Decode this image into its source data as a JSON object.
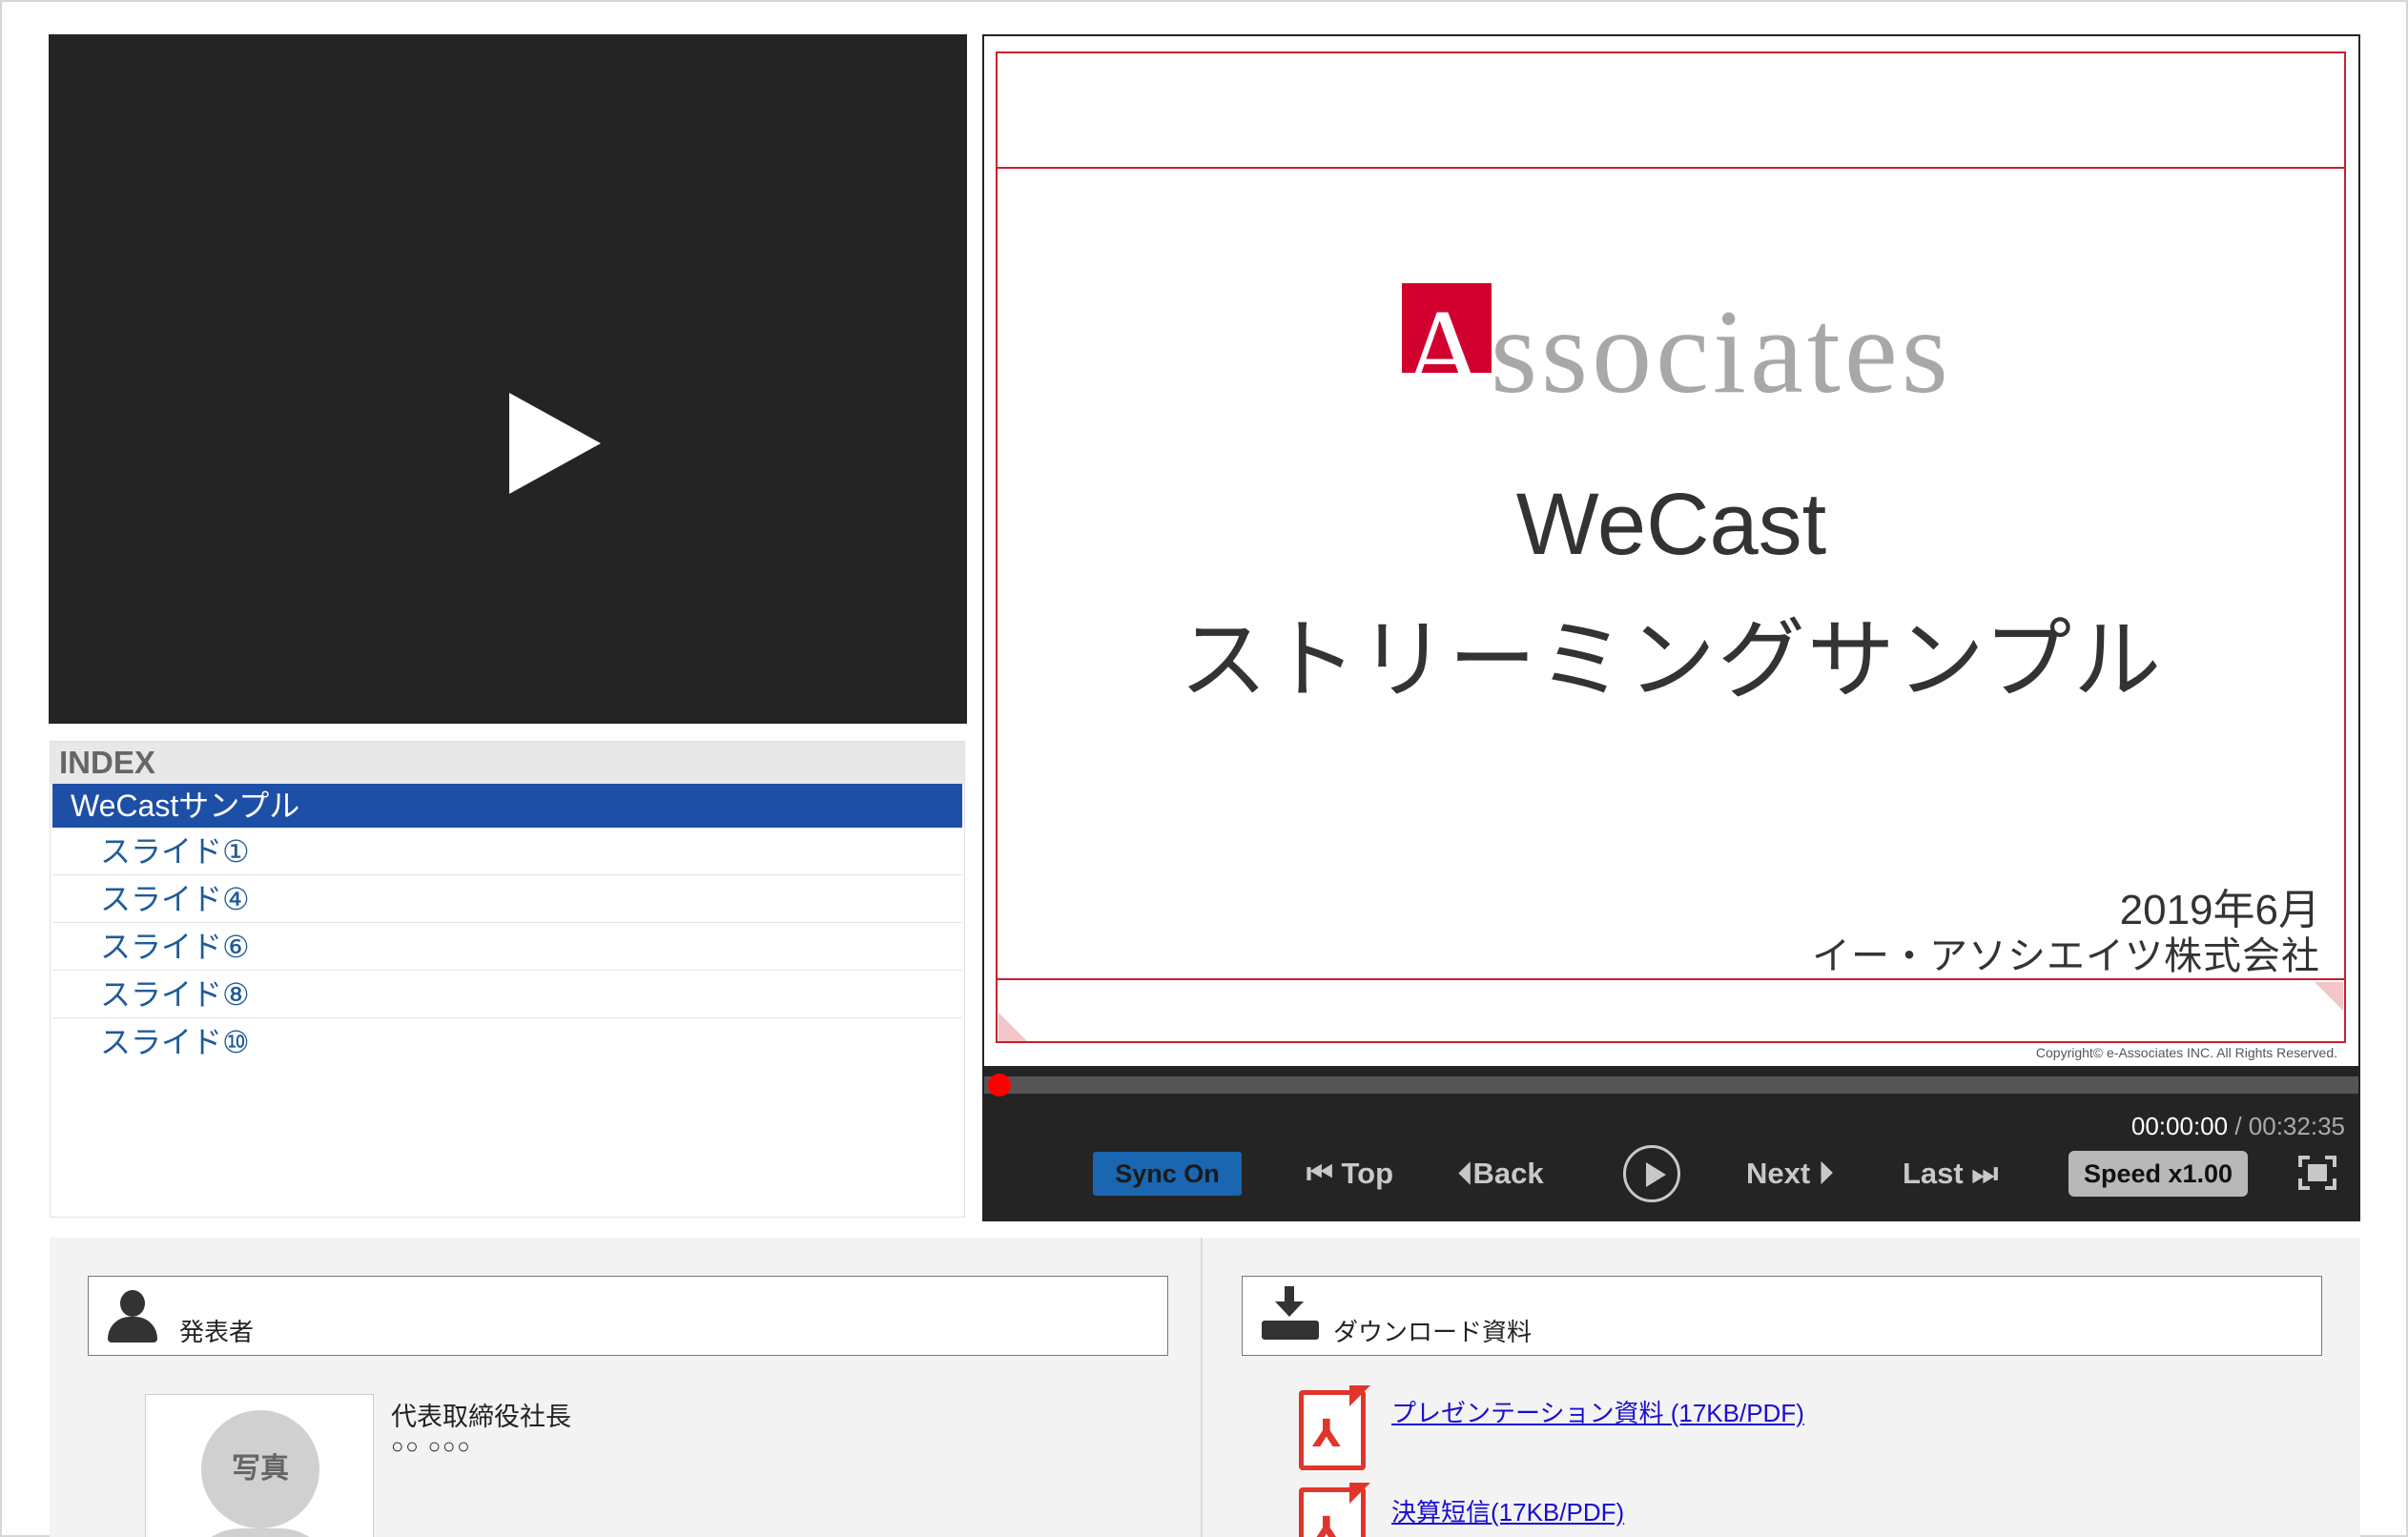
{
  "video": {
    "play_icon": "play-icon"
  },
  "index": {
    "header": "INDEX",
    "selected": "WeCastサンプル",
    "items": [
      "スライド①",
      "スライド④",
      "スライド⑥",
      "スライド⑧",
      "スライド⑩"
    ]
  },
  "slide": {
    "logo_text": "Associates",
    "logo_letter": "A",
    "logo_rest": "ssociates",
    "title_line1": "WeCast",
    "title_line2": "ストリーミングサンプル",
    "date": "2019年6月",
    "company": "イー・アソシエイツ株式会社",
    "copyright": "Copyright© e-Associates INC. All Rights Reserved."
  },
  "player": {
    "time_current": "00:00:00",
    "time_separator": " / ",
    "time_total": "00:32:35",
    "progress": 0,
    "sync_label": "Sync On",
    "top_label": "⏮ Top",
    "back_label": "⏴Back",
    "next_label": "Next ⏵",
    "last_label": "Last ⏭",
    "speed_label": "Speed x1.00"
  },
  "presenter": {
    "heading": "発表者",
    "photo_label": "写真",
    "role": "代表取締役社長",
    "name": "○○ ○○○"
  },
  "downloads": {
    "heading": "ダウンロード資料",
    "items": [
      "プレゼンテーション資料 (17KB/PDF)",
      "決算短信(17KB/PDF)"
    ]
  },
  "colors": {
    "index_selected_bg": "#1e4fa6",
    "slide_border": "#c8202e",
    "logo_red": "#d2002f",
    "sync_button": "#1a66b0",
    "pdf_red": "#e0352b"
  }
}
